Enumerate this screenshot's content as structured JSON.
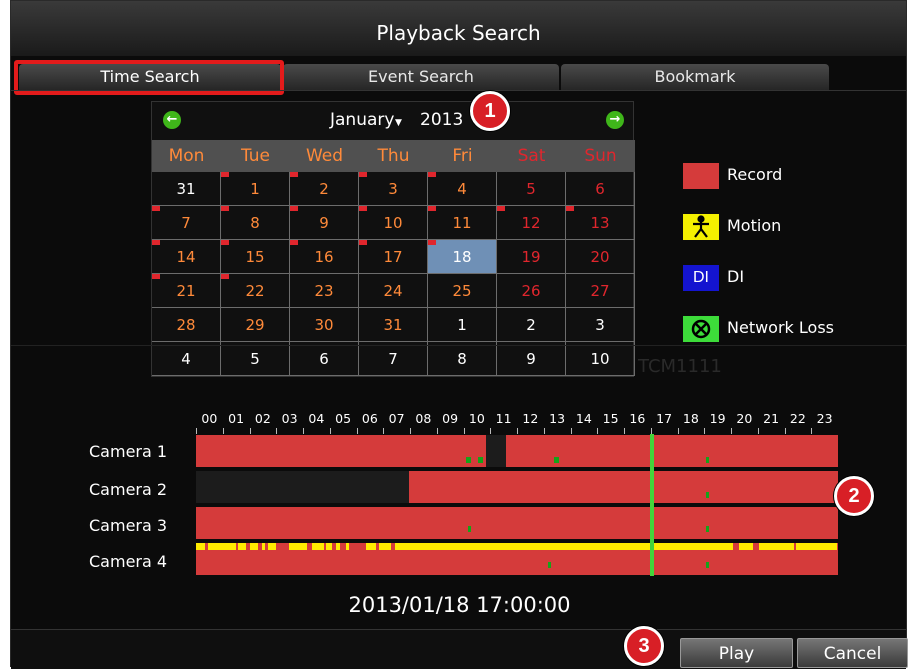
{
  "window": {
    "title": "Playback Search"
  },
  "tabs": [
    {
      "label": "Time Search"
    },
    {
      "label": "Event Search"
    },
    {
      "label": "Bookmark"
    }
  ],
  "calendar": {
    "month": "January",
    "year": "2013",
    "weekdays": [
      "Mon",
      "Tue",
      "Wed",
      "Thu",
      "Fri",
      "Sat",
      "Sun"
    ],
    "selected_day": "18",
    "rows": [
      [
        "31",
        "1",
        "2",
        "3",
        "4",
        "5",
        "6"
      ],
      [
        "7",
        "8",
        "9",
        "10",
        "11",
        "12",
        "13"
      ],
      [
        "14",
        "15",
        "16",
        "17",
        "18",
        "19",
        "20"
      ],
      [
        "21",
        "22",
        "23",
        "24",
        "25",
        "26",
        "27"
      ],
      [
        "28",
        "29",
        "30",
        "31",
        "1",
        "2",
        "3"
      ],
      [
        "4",
        "5",
        "6",
        "7",
        "8",
        "9",
        "10"
      ]
    ]
  },
  "legend": [
    {
      "label": "Record",
      "color": "#d53b3b",
      "icon": "record-swatch"
    },
    {
      "label": "Motion",
      "color": "#f4f000",
      "icon": "motion-icon"
    },
    {
      "label": "DI",
      "color": "#1414d0",
      "icon": "di-icon"
    },
    {
      "label": "Network Loss",
      "color": "#3ddc3a",
      "icon": "network-loss-icon"
    }
  ],
  "watermark": "TCM1111",
  "timeline": {
    "hours": [
      "00",
      "01",
      "02",
      "03",
      "04",
      "05",
      "06",
      "07",
      "08",
      "09",
      "10",
      "11",
      "12",
      "13",
      "14",
      "15",
      "16",
      "17",
      "18",
      "19",
      "20",
      "21",
      "22",
      "23"
    ],
    "cameras": [
      {
        "label": "Camera 1"
      },
      {
        "label": "Camera 2"
      },
      {
        "label": "Camera 3"
      },
      {
        "label": "Camera 4"
      }
    ],
    "cursor_time": "2013/01/18 17:00:00"
  },
  "callouts": [
    "1",
    "2",
    "3"
  ],
  "buttons": {
    "play": "Play",
    "cancel": "Cancel"
  },
  "colors": {
    "record": "#d53b3b",
    "motion": "#ffeb00",
    "cursor": "#43d43a",
    "selected": "#6f90b6",
    "weekend": "#e0262d",
    "weekday_header": "#ff8a3a",
    "current_month": "#ff8a3a",
    "other_month": "#ffffff"
  }
}
